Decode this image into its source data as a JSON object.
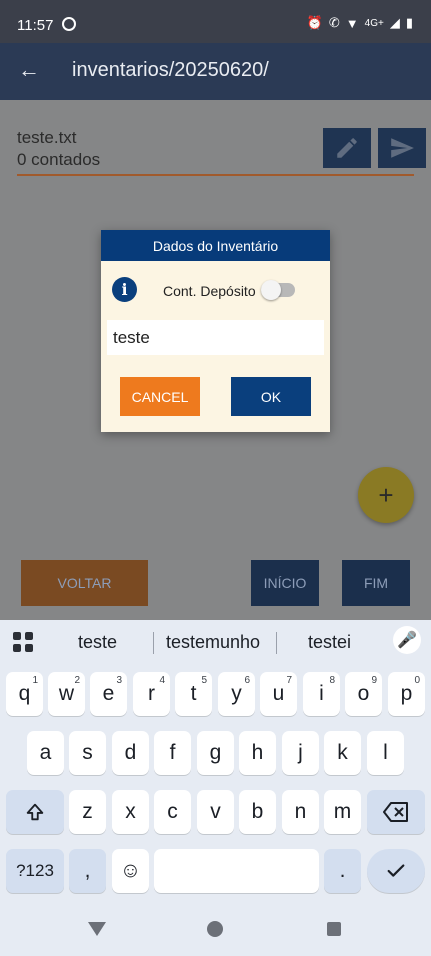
{
  "status_bar": {
    "time": "11:57",
    "right_text": "4G+"
  },
  "app_bar": {
    "back_icon": "arrow-left-icon",
    "title": "inventarios/20250620/"
  },
  "file": {
    "name": "teste.txt",
    "count": "0 contados"
  },
  "actions": {
    "edit_icon": "pencil-icon",
    "send_icon": "send-icon",
    "back_label": "VOLTAR",
    "start_label": "INÍCIO",
    "end_label": "FIM",
    "fab_label": "+"
  },
  "dialog": {
    "title": "Dados do Inventário",
    "toggle_label": "Cont. Depósito",
    "toggle_on": false,
    "input_value": "teste",
    "cancel_label": "CANCEL",
    "ok_label": "OK"
  },
  "keyboard": {
    "suggestions": [
      "teste",
      "testemunho",
      "testei"
    ],
    "row1": [
      {
        "k": "q",
        "n": "1"
      },
      {
        "k": "w",
        "n": "2"
      },
      {
        "k": "e",
        "n": "3"
      },
      {
        "k": "r",
        "n": "4"
      },
      {
        "k": "t",
        "n": "5"
      },
      {
        "k": "y",
        "n": "6"
      },
      {
        "k": "u",
        "n": "7"
      },
      {
        "k": "i",
        "n": "8"
      },
      {
        "k": "o",
        "n": "9"
      },
      {
        "k": "p",
        "n": "0"
      }
    ],
    "row2": [
      "a",
      "s",
      "d",
      "f",
      "g",
      "h",
      "j",
      "k",
      "l"
    ],
    "row3": [
      "z",
      "x",
      "c",
      "v",
      "b",
      "n",
      "m"
    ],
    "symbols_label": "?123",
    "comma_label": ",",
    "period_label": ".",
    "emoji_label": "☺"
  },
  "colors": {
    "dialog_header": "#073b7a",
    "cancel_button": "#ee7a1e",
    "ok_button": "#0a3f7d"
  }
}
